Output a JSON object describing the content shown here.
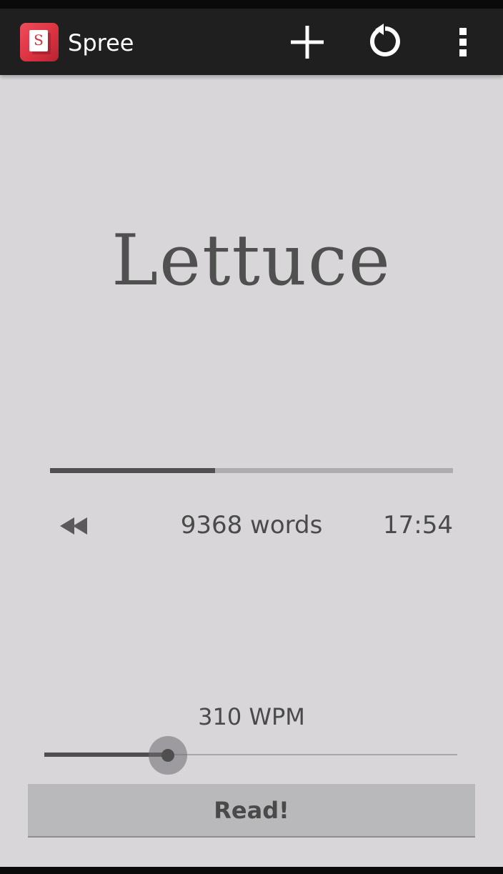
{
  "app": {
    "title": "Spree",
    "icon_letter": "S",
    "brand_color": "#e03a48"
  },
  "toolbar": {
    "add_icon": "plus-icon",
    "restart_icon": "restart-icon",
    "overflow_icon": "overflow-menu-icon"
  },
  "reader": {
    "current_word": "Lettuce",
    "progress_fraction": 0.41,
    "rewind_icon": "rewind-icon",
    "word_count": "9368 words",
    "time_remaining": "17:54"
  },
  "speed": {
    "label": "310 WPM",
    "slider_fraction": 0.3
  },
  "read_button_label": "Read!"
}
